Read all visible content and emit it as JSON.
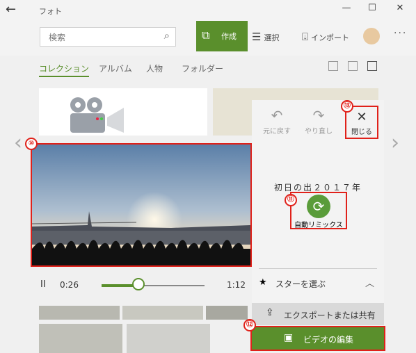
{
  "app": {
    "title": "フォト"
  },
  "window": {
    "minimize": "—",
    "maximize": "☐",
    "close": "✕"
  },
  "search": {
    "placeholder": "検索"
  },
  "toolbar": {
    "create_label": "作成",
    "select_label": "選択",
    "import_label": "インポート",
    "more": "···"
  },
  "nav": {
    "tabs": [
      "コレクション",
      "アルバム",
      "人物",
      "フォルダー"
    ]
  },
  "player": {
    "play_icon": "II",
    "current_time": "0:26",
    "duration": "1:12",
    "progress": 0.36
  },
  "panel": {
    "undo_label": "元に戻す",
    "redo_label": "やり直し",
    "close_label": "閉じる",
    "remix_title": "初日の出２０１７年",
    "remix_label": "自動リミックス",
    "star_label": "スターを選ぶ",
    "export_label": "エクスポートまたは共有",
    "edit_label": "ビデオの編集"
  },
  "markers": {
    "m10": "⑩",
    "m11": "⑪",
    "m12": "⑫",
    "m13": "⑬"
  },
  "colors": {
    "accent": "#5a8f2c",
    "highlight": "#e0211a"
  }
}
